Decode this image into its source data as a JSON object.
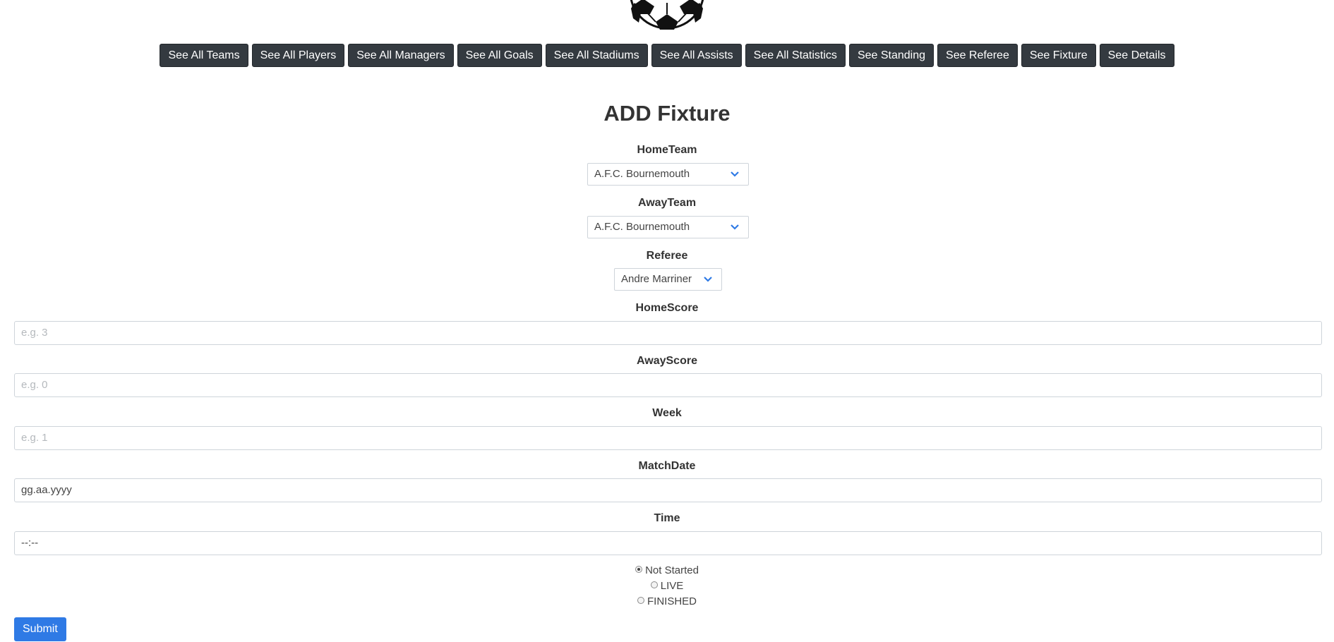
{
  "nav": {
    "items": [
      {
        "label": "See All Teams"
      },
      {
        "label": "See All Players"
      },
      {
        "label": "See All Managers"
      },
      {
        "label": "See All Goals"
      },
      {
        "label": "See All Stadiums"
      },
      {
        "label": "See All Assists"
      },
      {
        "label": "See All Statistics"
      },
      {
        "label": "See Standing"
      },
      {
        "label": "See Referee"
      },
      {
        "label": "See Fixture"
      },
      {
        "label": "See Details"
      }
    ]
  },
  "form": {
    "title": "ADD Fixture",
    "home_team": {
      "label": "HomeTeam",
      "value": "A.F.C. Bournemouth"
    },
    "away_team": {
      "label": "AwayTeam",
      "value": "A.F.C. Bournemouth"
    },
    "referee": {
      "label": "Referee",
      "value": "Andre Marriner"
    },
    "home_score": {
      "label": "HomeScore",
      "placeholder": "e.g. 3"
    },
    "away_score": {
      "label": "AwayScore",
      "placeholder": "e.g. 0"
    },
    "week": {
      "label": "Week",
      "placeholder": "e.g. 1"
    },
    "match_date": {
      "label": "MatchDate",
      "value": "gg.aa.yyyy"
    },
    "time": {
      "label": "Time",
      "value": "--:--"
    },
    "status_options": [
      {
        "label": "Not Started",
        "checked": true
      },
      {
        "label": "LIVE",
        "checked": false
      },
      {
        "label": "FINISHED",
        "checked": false
      }
    ],
    "submit_label": "Submit"
  },
  "colors": {
    "nav_bg": "#343a40",
    "submit_bg": "#2f7ae5",
    "chevron": "#2f7ae5"
  }
}
